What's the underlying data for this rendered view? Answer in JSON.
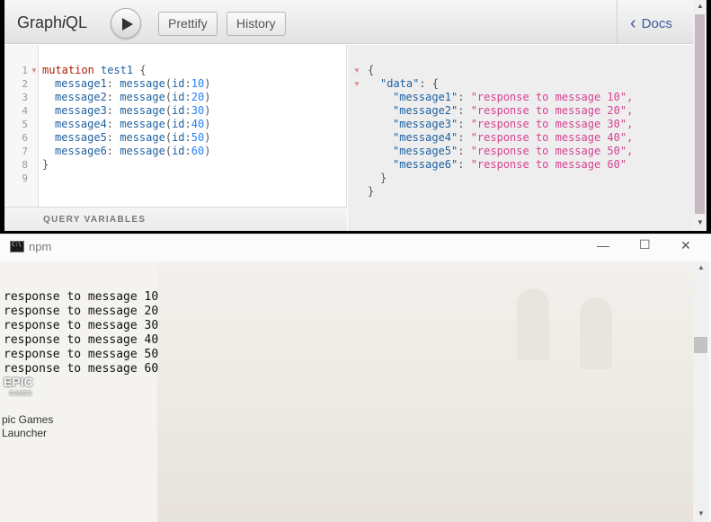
{
  "graphiql": {
    "logo_prefix": "Graph",
    "logo_italic": "i",
    "logo_suffix": "QL",
    "prettify_label": "Prettify",
    "history_label": "History",
    "docs_label": "Docs",
    "query_variables_label": "QUERY VARIABLES",
    "line_numbers": [
      "1",
      "2",
      "3",
      "4",
      "5",
      "6",
      "7",
      "8",
      "9"
    ],
    "query": {
      "keyword": "mutation",
      "name": "test1",
      "fields": [
        {
          "alias": "message1",
          "fn": "message",
          "arg": "id",
          "value": "10"
        },
        {
          "alias": "message2",
          "fn": "message",
          "arg": "id",
          "value": "20"
        },
        {
          "alias": "message3",
          "fn": "message",
          "arg": "id",
          "value": "30"
        },
        {
          "alias": "message4",
          "fn": "message",
          "arg": "id",
          "value": "40"
        },
        {
          "alias": "message5",
          "fn": "message",
          "arg": "id",
          "value": "50"
        },
        {
          "alias": "message6",
          "fn": "message",
          "arg": "id",
          "value": "60"
        }
      ]
    },
    "result": {
      "data_key": "\"data\"",
      "entries": [
        {
          "key": "\"message1\"",
          "value": "\"response to message 10\","
        },
        {
          "key": "\"message2\"",
          "value": "\"response to message 20\","
        },
        {
          "key": "\"message3\"",
          "value": "\"response to message 30\","
        },
        {
          "key": "\"message4\"",
          "value": "\"response to message 40\","
        },
        {
          "key": "\"message5\"",
          "value": "\"response to message 50\","
        },
        {
          "key": "\"message6\"",
          "value": "\"response to message 60\""
        }
      ]
    }
  },
  "console": {
    "title": "npm",
    "icon_text": "C:\\",
    "output": [
      "response to message 10",
      "response to message 20",
      "response to message 30",
      "response to message 40",
      "response to message 50",
      "response to message 60"
    ],
    "desktop_icon_line1": "pic Games",
    "desktop_icon_line2": "Launcher",
    "desktop_logo_text": "EPIC",
    "desktop_logo_sub": "GAMES"
  },
  "icons": [
    "play-icon",
    "chevron-left-icon",
    "minimize-icon",
    "maximize-icon",
    "close-icon",
    "cmd-icon"
  ],
  "colors": {
    "keyword": "#b11a04",
    "field": "#1f61a0",
    "number": "#2882f9",
    "string": "#d64292",
    "docs_link": "#3b5998"
  }
}
